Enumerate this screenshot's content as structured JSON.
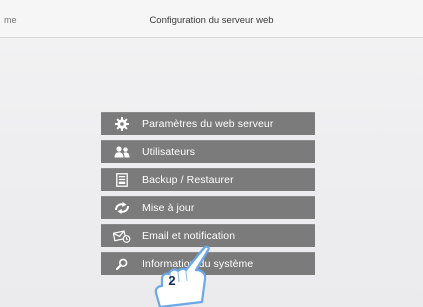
{
  "topbar": {
    "back_label": "me",
    "title": "Configuration du serveur web"
  },
  "menu": {
    "items": [
      {
        "label": "Paramètres du web serveur",
        "icon": "gear-icon"
      },
      {
        "label": "Utilisateurs",
        "icon": "users-icon"
      },
      {
        "label": "Backup / Restaurer",
        "icon": "backup-icon"
      },
      {
        "label": "Mise à jour",
        "icon": "update-icon"
      },
      {
        "label": "Email et notification",
        "icon": "email-icon"
      },
      {
        "label": "Information du système",
        "icon": "search-icon"
      }
    ]
  },
  "annotation": {
    "step_number": "2"
  },
  "colors": {
    "menu_background": "#7b7b7b",
    "menu_text": "#ffffff",
    "pointer_fill": "#ffffff",
    "pointer_outline": "#6aa8e8"
  }
}
